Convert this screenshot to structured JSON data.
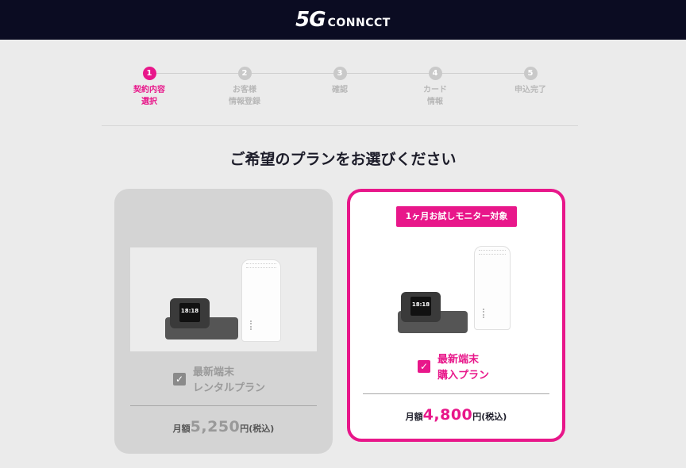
{
  "header": {
    "logo_5g": "5G",
    "logo_text": "CONNCCT"
  },
  "steps": [
    {
      "number": "1",
      "label": "契約内容\n選択",
      "active": true
    },
    {
      "number": "2",
      "label": "お客様\n情報登録",
      "active": false
    },
    {
      "number": "3",
      "label": "確認",
      "active": false
    },
    {
      "number": "4",
      "label": "カード\n情報",
      "active": false
    },
    {
      "number": "5",
      "label": "申込完了",
      "active": false
    }
  ],
  "page_title": "ご希望のプランをお選びください",
  "plans": {
    "rental": {
      "label": "最新端末\nレンタルプラン",
      "checked": true,
      "price_prefix": "月額",
      "price_value": "5,250",
      "price_suffix": "円(税込)",
      "device_time": "18:18"
    },
    "purchase": {
      "badge": "1ヶ月お試しモニター対象",
      "label": "最新端末\n購入プラン",
      "checked": true,
      "price_prefix": "月額",
      "price_value": "4,800",
      "price_suffix": "円(税込)",
      "device_time": "18:18"
    }
  },
  "colors": {
    "accent": "#e8178a",
    "header_bg": "#0b0c22",
    "page_bg": "#ebebeb"
  }
}
